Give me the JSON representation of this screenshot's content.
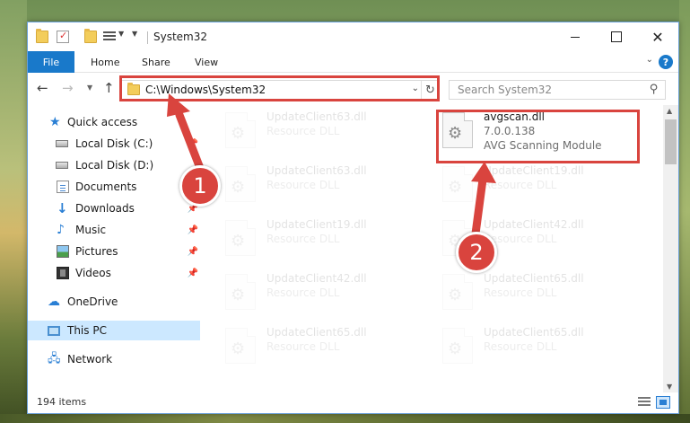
{
  "window": {
    "title": "System32",
    "controls": {
      "minimize": "",
      "maximize": "",
      "close": "✕"
    }
  },
  "ribbon": {
    "file": "File",
    "tabs": [
      "Home",
      "Share",
      "View"
    ],
    "help": "?"
  },
  "address": {
    "path": "C:\\Windows\\System32",
    "search_placeholder": "Search System32"
  },
  "nav": {
    "items": [
      {
        "label": "Quick access",
        "icon": "star-icon"
      },
      {
        "label": "Local Disk (C:)",
        "icon": "drive-icon",
        "pinned": true
      },
      {
        "label": "Local Disk (D:)",
        "icon": "drive-icon"
      },
      {
        "label": "Documents",
        "icon": "documents-icon",
        "pinned": true
      },
      {
        "label": "Downloads",
        "icon": "download-icon",
        "pinned": true
      },
      {
        "label": "Music",
        "icon": "music-icon",
        "pinned": true
      },
      {
        "label": "Pictures",
        "icon": "pictures-icon",
        "pinned": true
      },
      {
        "label": "Videos",
        "icon": "videos-icon",
        "pinned": true
      },
      {
        "label": "OneDrive",
        "icon": "cloud-icon"
      },
      {
        "label": "This PC",
        "icon": "computer-icon",
        "selected": true
      },
      {
        "label": "Network",
        "icon": "network-icon"
      }
    ]
  },
  "files": [
    {
      "name": "UpdateClient63.dll",
      "line2": "Resource DLL",
      "line3": ""
    },
    {
      "name": "avgscan.dll",
      "line2": "7.0.0.138",
      "line3": "AVG Scanning Module"
    },
    {
      "name": "UpdateClient63.dll",
      "line2": "Resource DLL",
      "line3": ""
    },
    {
      "name": "UpdateClient19.dll",
      "line2": "Resource DLL",
      "line3": ""
    },
    {
      "name": "UpdateClient19.dll",
      "line2": "Resource DLL",
      "line3": ""
    },
    {
      "name": "UpdateClient42.dll",
      "line2": "Resource DLL",
      "line3": ""
    },
    {
      "name": "UpdateClient42.dll",
      "line2": "Resource DLL",
      "line3": ""
    },
    {
      "name": "UpdateClient65.dll",
      "line2": "Resource DLL",
      "line3": ""
    },
    {
      "name": "UpdateClient65.dll",
      "line2": "Resource DLL",
      "line3": ""
    },
    {
      "name": "UpdateClient65.dll",
      "line2": "Resource DLL",
      "line3": ""
    }
  ],
  "status": {
    "item_count": "194 items"
  },
  "annotations": {
    "callout1": "1",
    "callout2": "2",
    "color": "#d9443e"
  }
}
